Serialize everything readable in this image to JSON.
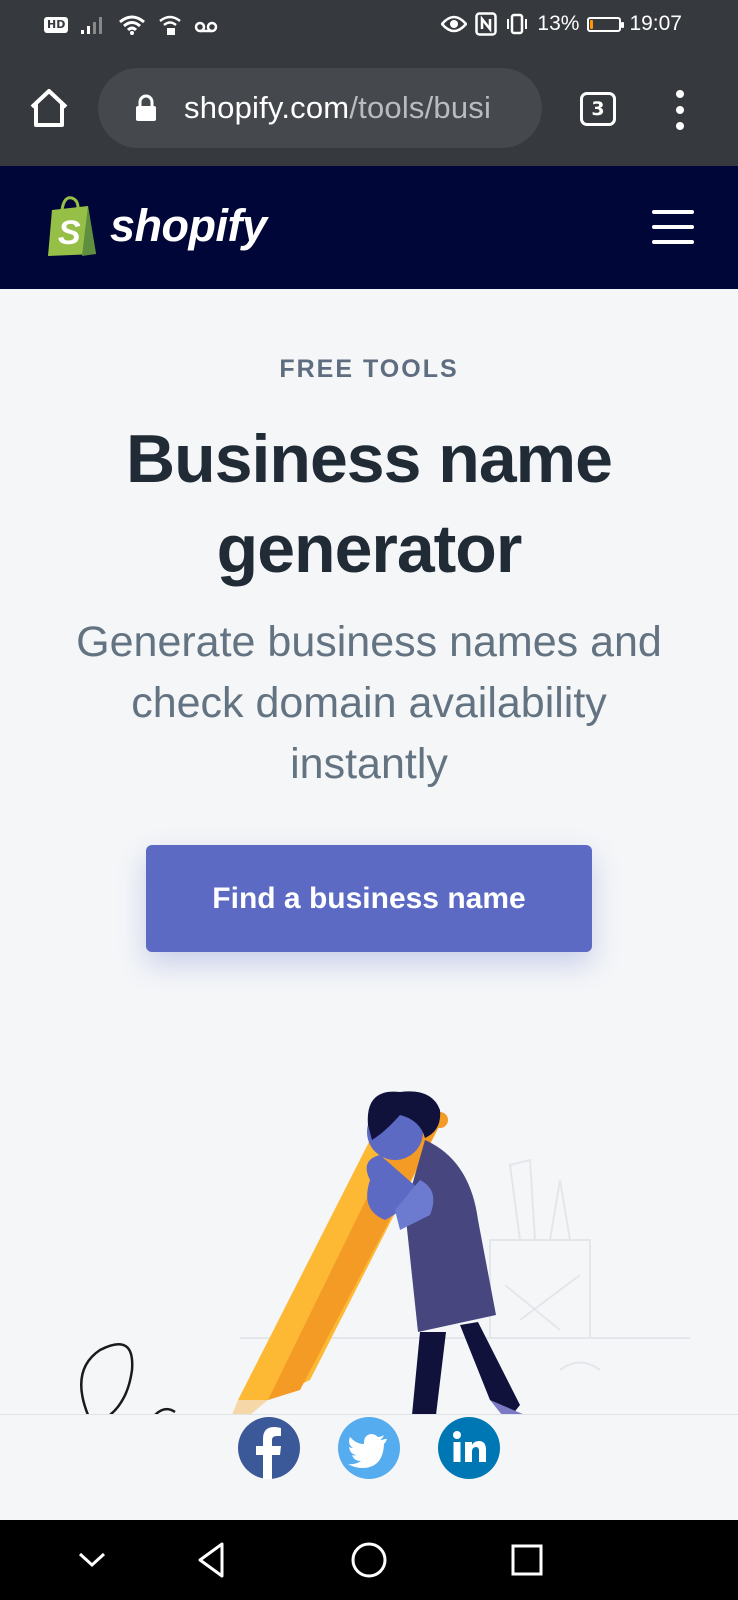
{
  "status_bar": {
    "hd": "HD",
    "battery_percent": "13%",
    "time": "19:07",
    "battery_level": 0.13,
    "battery_color": "#ff9800"
  },
  "browser": {
    "url_domain": "shopify.com",
    "url_path": "/tools/busi",
    "tab_count": "3"
  },
  "header": {
    "logo_text": "shopify",
    "brand_green": "#95bf47",
    "background": "#000638"
  },
  "hero": {
    "eyebrow": "FREE TOOLS",
    "title": "Business name generator",
    "subtitle": "Generate business names and check domain availability instantly",
    "cta_label": "Find a business name",
    "cta_color": "#5c6ac4"
  },
  "share": {
    "items": [
      {
        "icon": "facebook-icon",
        "color": "#3b5998"
      },
      {
        "icon": "twitter-icon",
        "color": "#55acee"
      },
      {
        "icon": "linkedin-icon",
        "color": "#0077b5"
      }
    ]
  },
  "nav": {
    "icons": [
      "collapse-icon",
      "back-icon",
      "home-icon",
      "recents-icon"
    ]
  }
}
